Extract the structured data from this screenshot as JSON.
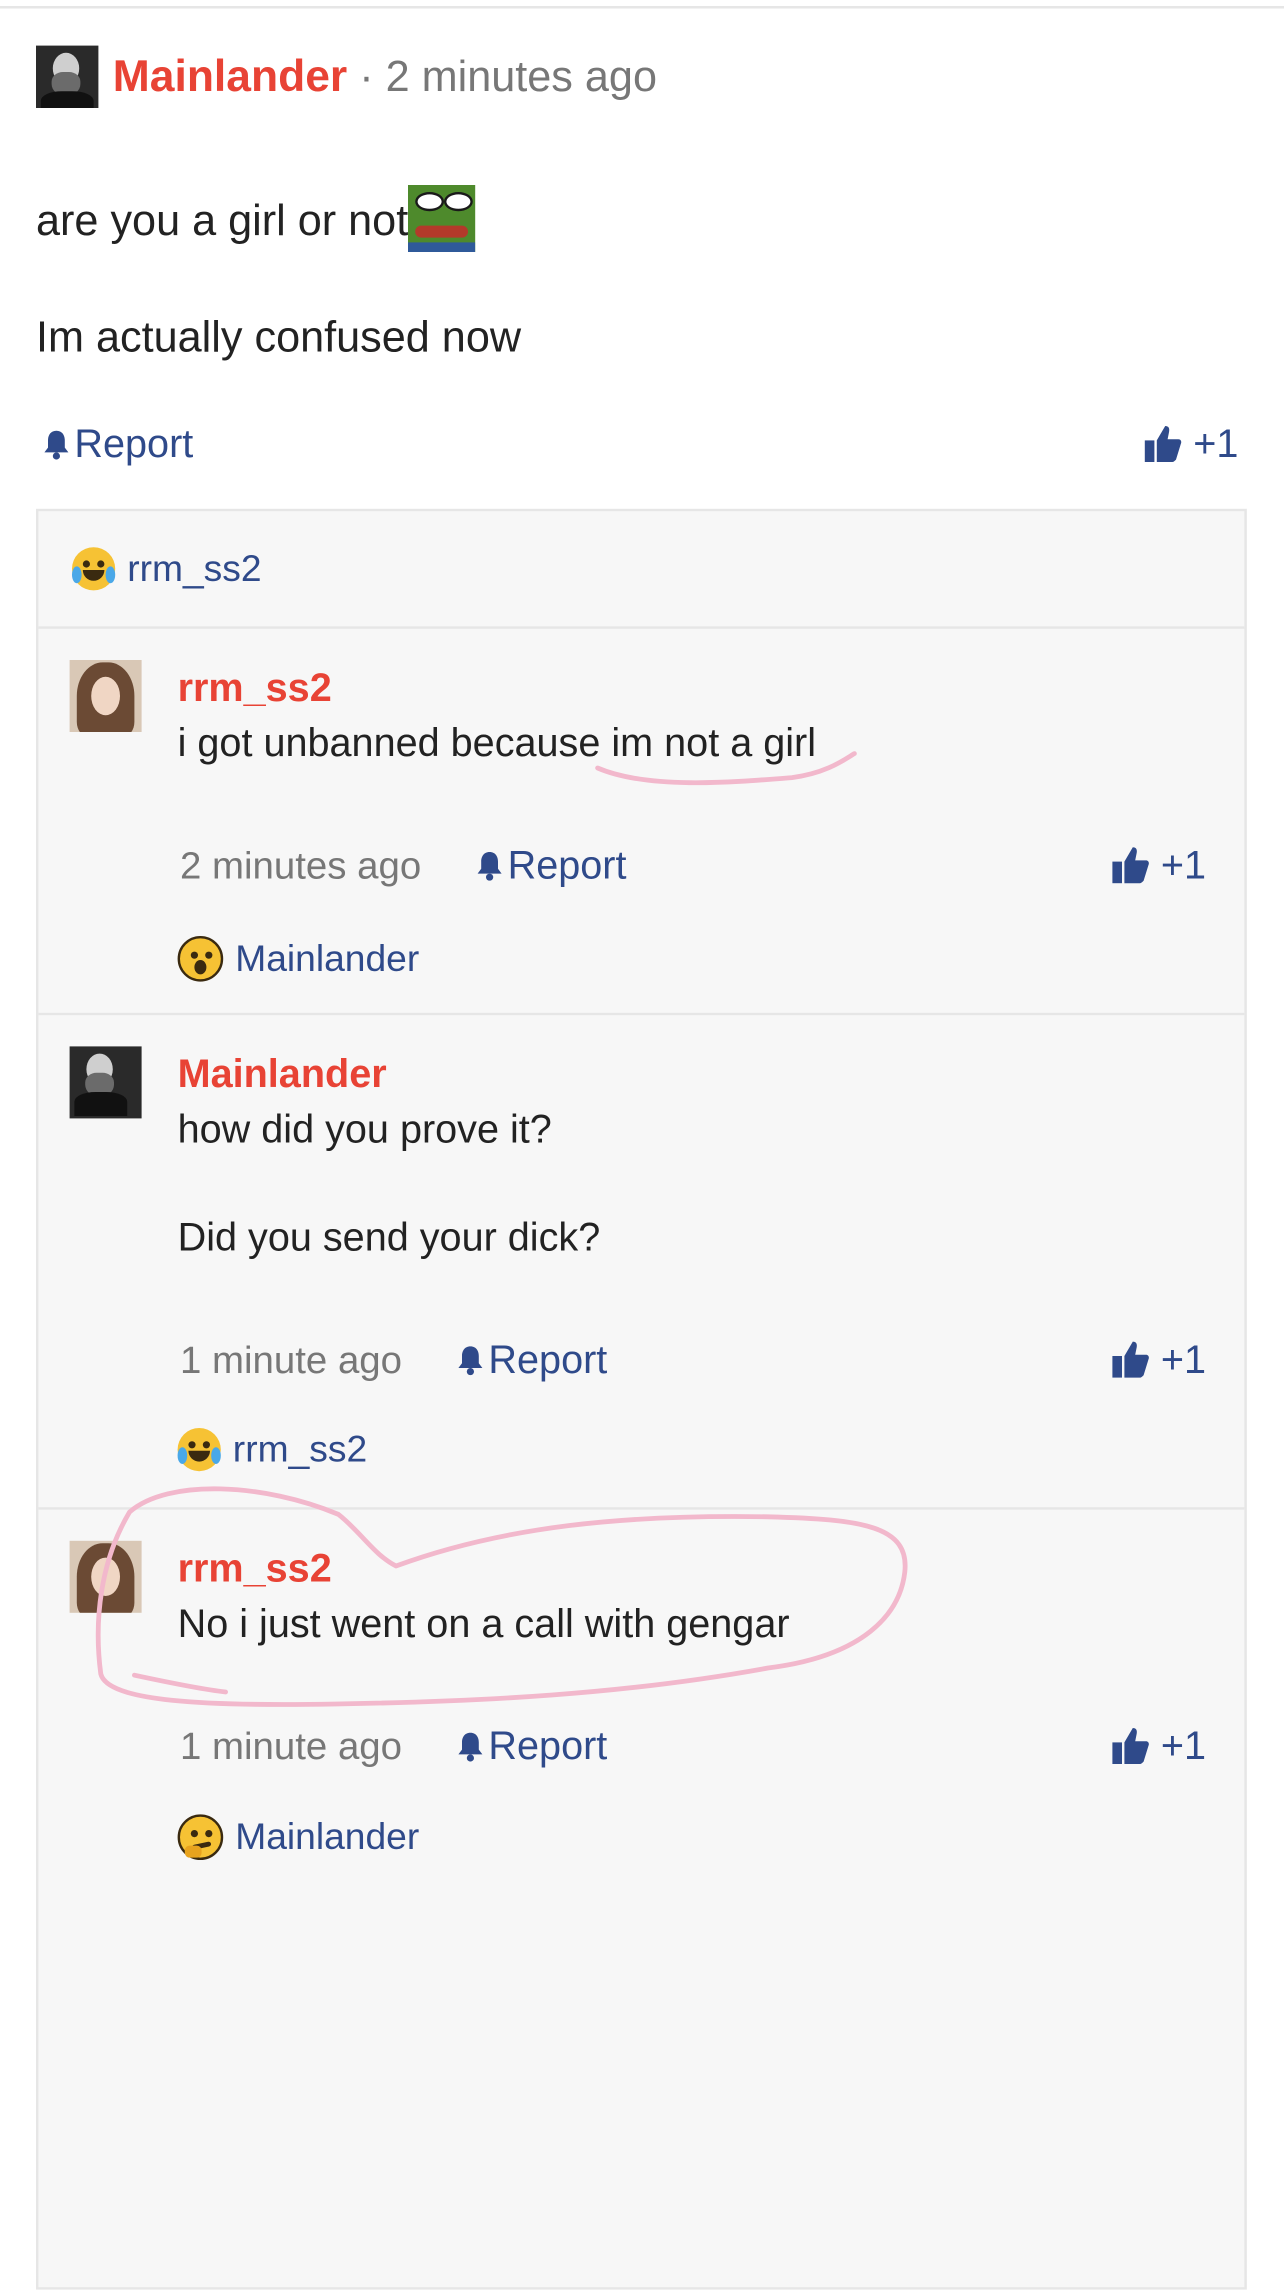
{
  "post": {
    "author": "Mainlander",
    "separator": "·",
    "time": "2 minutes ago",
    "line1": "are you a girl or not",
    "line2": "Im actually confused now",
    "report_label": "Report",
    "like_label": "+1"
  },
  "thread_header": {
    "reaction_user": "rrm_ss2",
    "reaction_icon": "crying-laughing-emoji"
  },
  "replies": [
    {
      "author": "rrm_ss2",
      "lines": [
        "i got unbanned because im not a girl"
      ],
      "time": "2 minutes ago",
      "report_label": "Report",
      "like_label": "+1",
      "reaction_user": "Mainlander",
      "reaction_icon": "astonished-emoji"
    },
    {
      "author": "Mainlander",
      "lines": [
        "how did you prove it?",
        "Did you send your dick?"
      ],
      "time": "1 minute ago",
      "report_label": "Report",
      "like_label": "+1",
      "reaction_user": "rrm_ss2",
      "reaction_icon": "crying-laughing-emoji"
    },
    {
      "author": "rrm_ss2",
      "lines": [
        "No i just went on a call with gengar"
      ],
      "time": "1 minute ago",
      "report_label": "Report",
      "like_label": "+1",
      "reaction_user": "Mainlander",
      "reaction_icon": "thinking-emoji"
    }
  ],
  "colors": {
    "author": "#e84335",
    "link": "#2f4a8a",
    "muted": "#777777",
    "annotation": "#f2b8cc"
  }
}
